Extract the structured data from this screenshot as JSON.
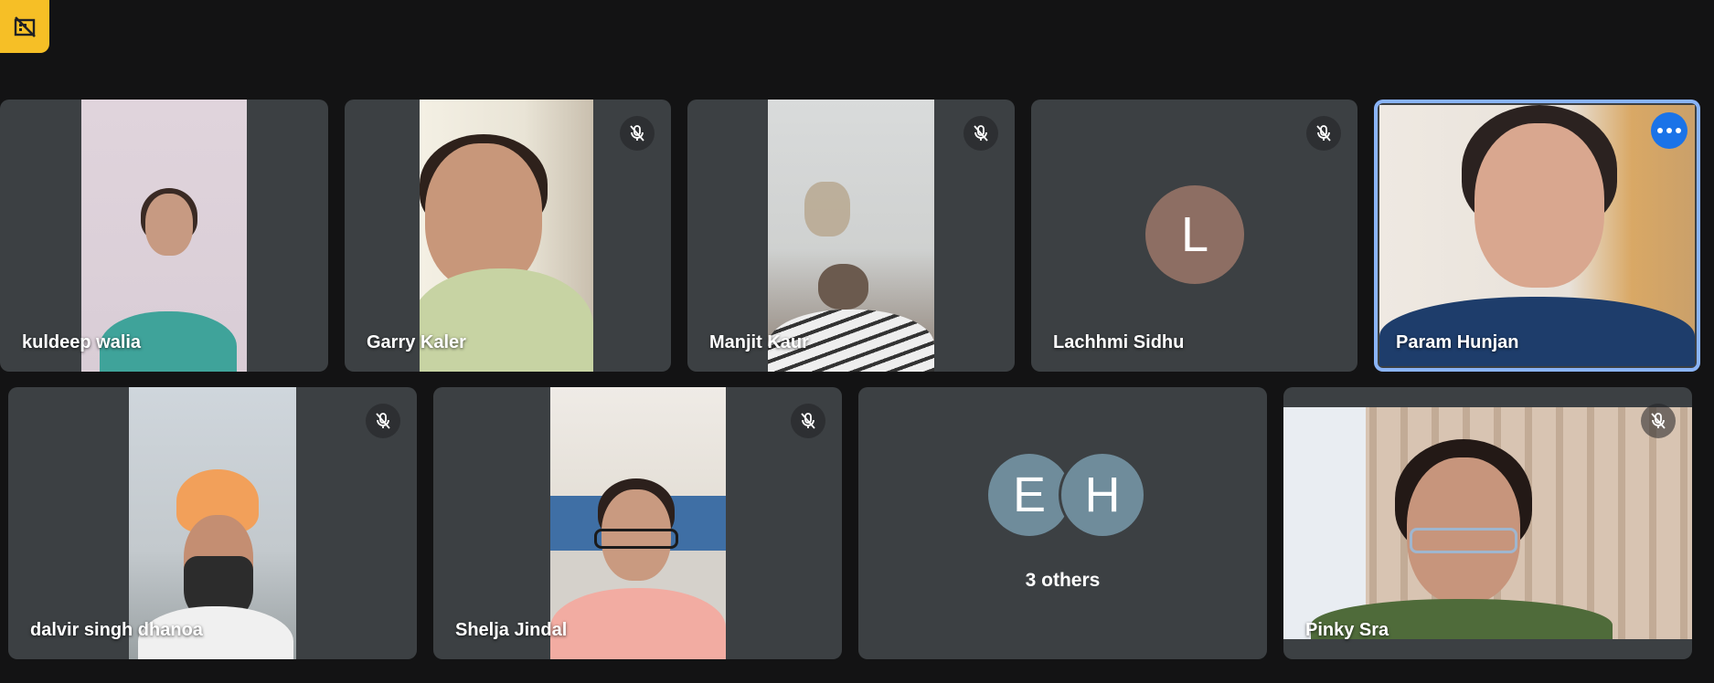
{
  "badge": {
    "icon": "recording-off-icon",
    "color": "#f6bf26"
  },
  "participants": [
    {
      "name": "kuldeep walia",
      "muted": false
    },
    {
      "name": "Garry Kaler",
      "muted": true
    },
    {
      "name": "Manjit Kaur",
      "muted": true
    },
    {
      "name": "Lachhmi Sidhu",
      "muted": true,
      "initial": "L",
      "avatar_color": "#8d6e63"
    },
    {
      "name": "Param Hunjan",
      "muted": false,
      "active": true
    },
    {
      "name": "dalvir singh dhanoa",
      "muted": true
    },
    {
      "name": "Shelja Jindal",
      "muted": true
    },
    {
      "name": "Pinky Sra",
      "muted": true
    }
  ],
  "others": {
    "label": "3 others",
    "initials": [
      "E",
      "H"
    ],
    "avatar_color": "#6f8c9b"
  },
  "colors": {
    "background": "#131314",
    "tile": "#3c4043",
    "active_border": "#8ab4f8",
    "more_button": "#1a73e8"
  }
}
